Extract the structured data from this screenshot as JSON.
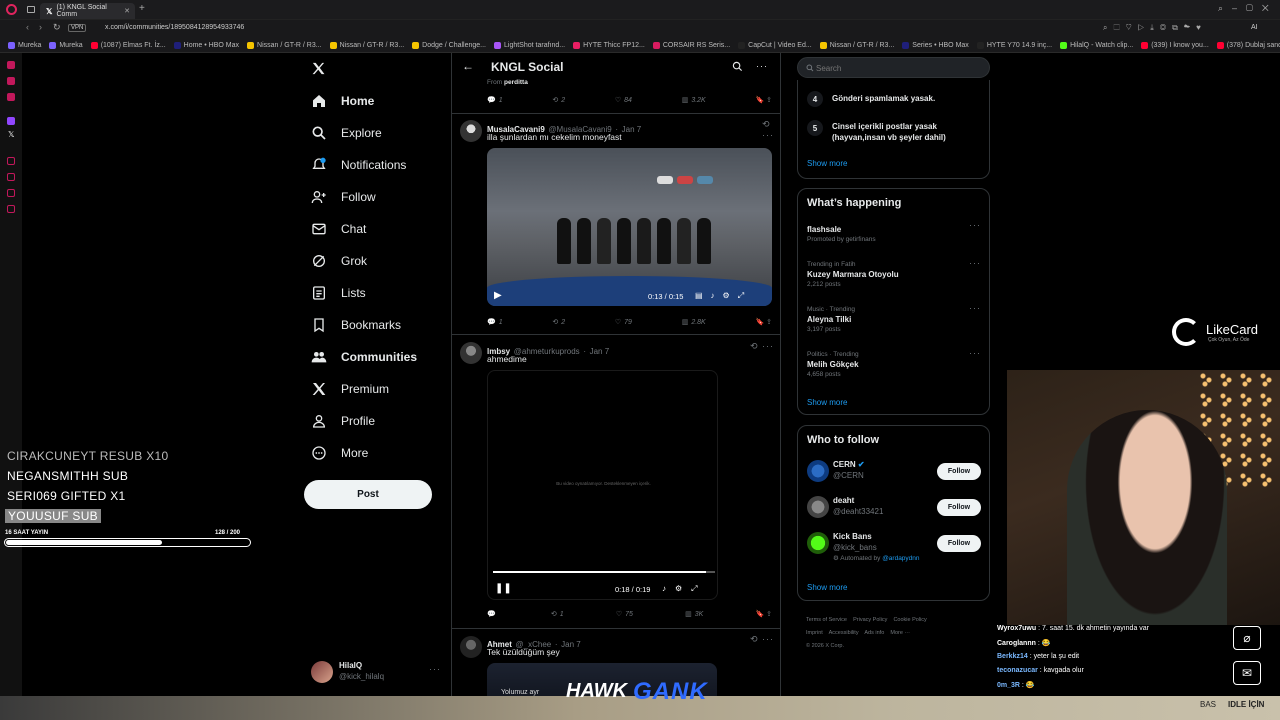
{
  "browser": {
    "tab_title": "(1) KNGL Social Comm",
    "vpn": "VPN",
    "url": "x.com/i/communities/1895084128954933746",
    "bookmarks": [
      "Mureka",
      "Mureka",
      "(1087) Elmas Ft. İz...",
      "Home • HBO Max",
      "Nissan / GT-R / R3...",
      "Nissan / GT-R / R3...",
      "Dodge / Challenge...",
      "LightShot tarafınd...",
      "HYTE Thicc FP12...",
      "CORSAIR RS Seris...",
      "CapCut | Video Ed...",
      "Nissan / GT-R / R3...",
      "Series • HBO Max",
      "HYTE Y70 14.9 inç...",
      "HilalQ - Watch clip...",
      "(339) I know you...",
      "(378) Dublaj sandı..."
    ],
    "ai_label": "AI"
  },
  "nav": {
    "items": [
      {
        "key": "home",
        "label": "Home",
        "bold": true
      },
      {
        "key": "explore",
        "label": "Explore"
      },
      {
        "key": "notifications",
        "label": "Notifications"
      },
      {
        "key": "follow",
        "label": "Follow"
      },
      {
        "key": "chat",
        "label": "Chat"
      },
      {
        "key": "grok",
        "label": "Grok"
      },
      {
        "key": "lists",
        "label": "Lists"
      },
      {
        "key": "bookmarks",
        "label": "Bookmarks"
      },
      {
        "key": "communities",
        "label": "Communities",
        "bold": true
      },
      {
        "key": "premium",
        "label": "Premium"
      },
      {
        "key": "profile",
        "label": "Profile"
      },
      {
        "key": "more",
        "label": "More"
      }
    ],
    "post_label": "Post",
    "account": {
      "name": "HilalQ",
      "handle": "@kick_hilalq"
    }
  },
  "feed": {
    "title": "KNGL Social",
    "top_post": {
      "from_label": "From",
      "from_name": "perditta",
      "replies": "1",
      "reposts": "2",
      "likes": "84",
      "views": "3.2K"
    },
    "posts": [
      {
        "name": "MusalaCavani9",
        "handle": "@MusalaCavani9",
        "date": "Jan 7",
        "text": "illa şunlardan mı cekelim moneyfast",
        "time": "0:13 / 0:15",
        "replies": "1",
        "reposts": "2",
        "likes": "79",
        "views": "2.8K"
      },
      {
        "name": "lmbsy",
        "handle": "@ahmeturkuprods",
        "date": "Jan 7",
        "text": "ahmedime",
        "video_msg": "Bu video oynatılamıyor. Desteklenmeyen içerik.",
        "time": "0:18 / 0:19",
        "replies": "",
        "reposts": "1",
        "likes": "75",
        "views": "3K"
      },
      {
        "name": "Ahmet",
        "handle": "@_xChee",
        "date": "Jan 7",
        "text": "Tek üzüldüğüm şey",
        "preview_text": "Yolumuz ayr"
      }
    ]
  },
  "right": {
    "search_placeholder": "Search",
    "rules": [
      {
        "num": "4",
        "text": "Gönderi spamlamak yasak."
      },
      {
        "num": "5",
        "text": "Cinsel içerikli postlar yasak (hayvan,insan vb şeyler dahil)"
      }
    ],
    "show_more": "Show more",
    "whats_happening": "What’s happening",
    "trends": [
      {
        "context": "",
        "title": "flashsale",
        "sub": "Promoted by getirfinans"
      },
      {
        "context": "Trending in Fatih",
        "title": "Kuzey Marmara Otoyolu",
        "sub": "2,212 posts"
      },
      {
        "context": "Music · Trending",
        "title": "Aleyna Tilki",
        "sub": "3,197 posts"
      },
      {
        "context": "Politics · Trending",
        "title": "Melih Gökçek",
        "sub": "4,658 posts"
      }
    ],
    "who_to_follow": "Who to follow",
    "follow_suggestions": [
      {
        "name": "CERN",
        "handle": "@CERN",
        "verified": true,
        "btn": "Follow"
      },
      {
        "name": "deaht",
        "handle": "@deaht33421",
        "btn": "Follow"
      },
      {
        "name": "Kick Bans",
        "handle": "@kick_bans",
        "automated_by_label": "Automated by",
        "automated_by": "@ardapydnn",
        "btn": "Follow"
      }
    ],
    "footer": [
      "Terms of Service",
      "Privacy Policy",
      "Cookie Policy",
      "Imprint",
      "Accessibility",
      "Ads info",
      "More ···",
      "© 2026 X Corp."
    ]
  },
  "stream_overlay": {
    "events": [
      "CIRAKCUNEYT  RESUB X10",
      "NEGANSMITHH  SUB",
      "SERI069  GIFTED X1",
      "YOUUSUF  SUB"
    ],
    "goal_label": "16 SAAT YAYIN",
    "goal_value": "128  / 200",
    "goal_fraction": 0.64,
    "likecard": "LikeCard",
    "likecard_sub": "Çok Oyun, Az Öde",
    "sponsor1": "HAWK",
    "sponsor2": "GANK",
    "chat": [
      {
        "user": "Wyrox7uwu",
        "msg": "7. saat 15. dk ahmetin yayında var",
        "color": "#ffffff"
      },
      {
        "user": "Caroglannn",
        "msg": "😂",
        "color": "#ffffff"
      },
      {
        "user": "Berkkz14",
        "msg": "yeter la şu edit",
        "color": "#7ab8ff"
      },
      {
        "user": "teconazucar",
        "msg": "kavgada olur",
        "color": "#7ab8ff"
      },
      {
        "user": "0m_3R",
        "msg": "😂",
        "color": "#7ab8ff"
      }
    ],
    "bas_label": "BAS",
    "idle_label": "IDLE İÇİN"
  },
  "colors": {
    "accent": "#1d9bf0",
    "bg": "#000000",
    "text": "#e7e9ea",
    "muted": "#71767b",
    "kick_green": "#53fc18"
  }
}
